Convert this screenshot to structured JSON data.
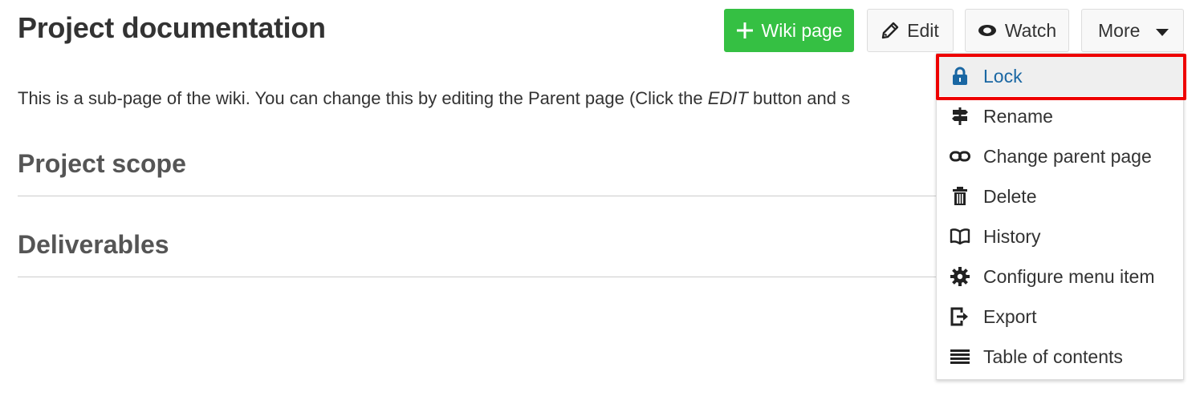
{
  "page": {
    "title": "Project documentation",
    "intro_before": "This is a sub-page of the wiki. You can change this by editing the Parent page (Click the ",
    "intro_emphasis": "EDIT",
    "intro_after": " button and s",
    "sections": [
      {
        "heading": "Project scope"
      },
      {
        "heading": "Deliverables"
      }
    ]
  },
  "toolbar": {
    "wiki_page_label": "Wiki page",
    "edit_label": "Edit",
    "watch_label": "Watch",
    "more_label": "More"
  },
  "more_menu": {
    "items": [
      {
        "label": "Lock",
        "icon": "lock-icon",
        "highlighted": true
      },
      {
        "label": "Rename",
        "icon": "signpost-icon"
      },
      {
        "label": "Change parent page",
        "icon": "link-icon"
      },
      {
        "label": "Delete",
        "icon": "trash-icon"
      },
      {
        "label": "History",
        "icon": "book-icon"
      },
      {
        "label": "Configure menu item",
        "icon": "gear-icon"
      },
      {
        "label": "Export",
        "icon": "export-icon"
      },
      {
        "label": "Table of contents",
        "icon": "list-icon"
      }
    ]
  },
  "colors": {
    "primary_button": "#35c043",
    "active_item_text": "#1a67a3",
    "highlight_outline": "#ee0000"
  }
}
